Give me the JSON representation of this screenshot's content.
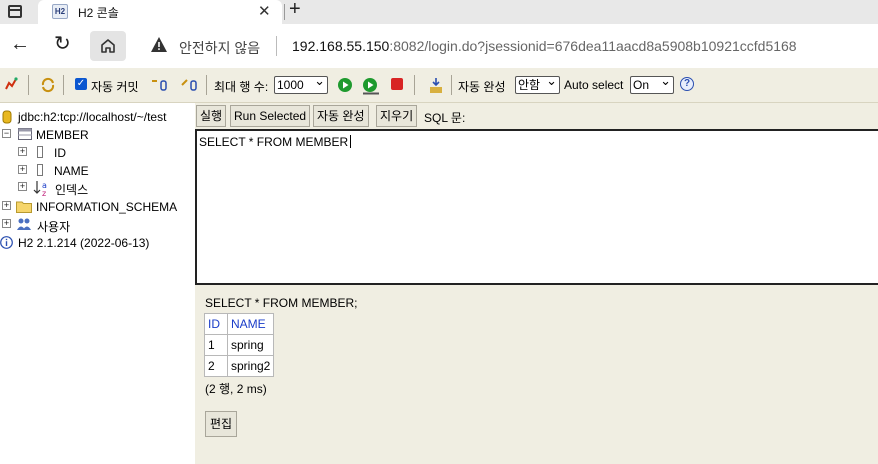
{
  "browser": {
    "tab_title": "H2 콘솔",
    "tab_favicon": "H2",
    "insecure_label": "안전하지 않음",
    "url_host": "192.168.55.150",
    "url_rest": ":8082/login.do?jsessionid=676dea11aacd8a5908b10921ccfd5168"
  },
  "toolbar": {
    "autocommit_label": "자동 커밋",
    "max_rows_label": "최대 행 수:",
    "max_rows_value": "1000",
    "autocomplete_label": "자동 완성",
    "autocomplete_value": "안함",
    "autoselect_label": "Auto select",
    "autoselect_value": "On"
  },
  "tree": {
    "connection": "jdbc:h2:tcp://localhost/~/test",
    "table": "MEMBER",
    "columns": [
      "ID",
      "NAME"
    ],
    "indexes": "인덱스",
    "info_schema": "INFORMATION_SCHEMA",
    "users": "사용자",
    "version": "H2 2.1.214 (2022-06-13)"
  },
  "query": {
    "run_label": "실행",
    "run_selected_label": "Run Selected",
    "autocomplete_label": "자동 완성",
    "clear_label": "지우기",
    "sql_label": "SQL 문:",
    "editor_text": "SELECT * FROM MEMBER"
  },
  "result": {
    "sql": "SELECT * FROM MEMBER;",
    "headers": [
      "ID",
      "NAME"
    ],
    "rows": [
      [
        "1",
        "spring"
      ],
      [
        "2",
        "spring2"
      ]
    ],
    "count_text": "(2 행, 2 ms)",
    "edit_label": "편집"
  }
}
